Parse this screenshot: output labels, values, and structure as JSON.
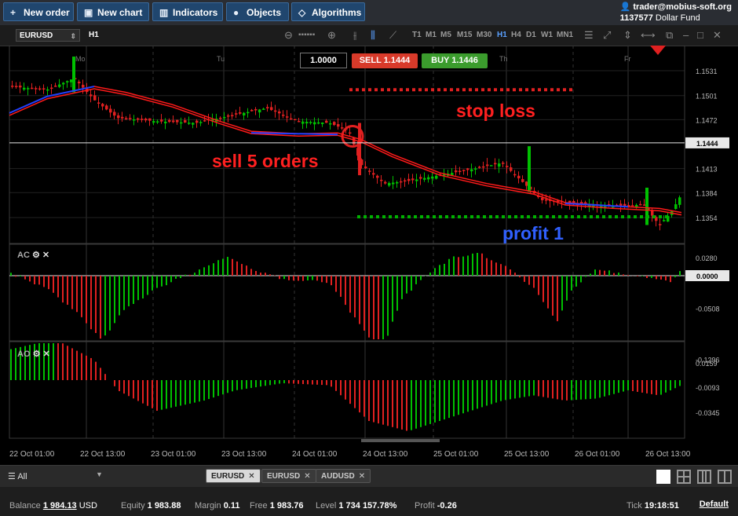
{
  "topbar": {
    "new_order": "New order",
    "new_chart": "New chart",
    "indicators": "Indicators",
    "objects": "Objects",
    "algorithms": "Algorithms",
    "account_email": "trader@mobius-soft.org",
    "account_id": "1137577",
    "account_name": "Dollar Fund"
  },
  "chart_toolbar": {
    "symbol": "EURUSD",
    "timeframe": "H1",
    "timeframes": [
      "T1",
      "M1",
      "M5",
      "M15",
      "M30",
      "H1",
      "H4",
      "D1",
      "W1",
      "MN1"
    ],
    "active_timeframe": "H1"
  },
  "trade_panel": {
    "quantity": "1.0000",
    "sell_label": "SELL 1.1444",
    "buy_label": "BUY 1.1446"
  },
  "annotations": {
    "stop_loss": "stop loss",
    "sell_orders": "sell 5 orders",
    "profit": "profit 1"
  },
  "day_labels": [
    "Mo",
    "Tu",
    "Th",
    "Fr"
  ],
  "price_axis": [
    "1.1531",
    "1.1501",
    "1.1472",
    "1.1413",
    "1.1384",
    "1.1354"
  ],
  "current_price": "1.1444",
  "ac_panel": {
    "label": "AC",
    "axis": [
      "0.0280",
      "-0.0508",
      "-0.1296"
    ],
    "zero": "0.0000"
  },
  "ao_panel": {
    "label": "AO",
    "axis": [
      "0.0159",
      "-0.0093",
      "-0.0345"
    ]
  },
  "time_axis": [
    "22 Oct 01:00",
    "22 Oct 13:00",
    "23 Oct 01:00",
    "23 Oct 13:00",
    "24 Oct 01:00",
    "24 Oct 13:00",
    "25 Oct 01:00",
    "25 Oct 13:00",
    "26 Oct 01:00",
    "26 Oct 13:00"
  ],
  "bottom": {
    "filter": "All",
    "tabs": [
      "EURUSD",
      "EURUSD",
      "AUDUSD"
    ]
  },
  "status": {
    "balance_label": "Balance",
    "balance": "1 984.13",
    "balance_ccy": "USD",
    "equity_label": "Equity",
    "equity": "1 983.88",
    "margin_label": "Margin",
    "margin": "0.11",
    "free_label": "Free",
    "free": "1 983.76",
    "level_label": "Level",
    "level": "1 734 157.78%",
    "profit_label": "Profit",
    "profit": "-0.26",
    "tick_label": "Tick",
    "tick": "19:18:51",
    "default": "Default"
  },
  "colors": {
    "bull": "#00c000",
    "bear": "#e02020",
    "ma_red": "#ff1a1a",
    "ma_blue": "#2040ff",
    "accent": "#20466e"
  }
}
